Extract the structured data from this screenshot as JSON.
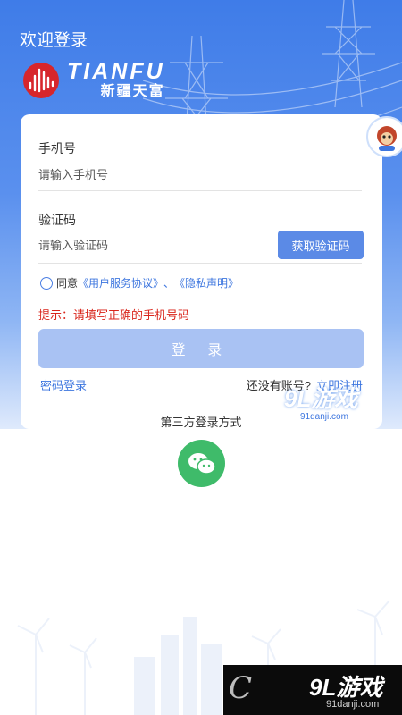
{
  "header": {
    "welcome": "欢迎登录",
    "logo_en": "TIANFU",
    "logo_cn": "新疆天富"
  },
  "form": {
    "phone_label": "手机号",
    "phone_placeholder": "请输入手机号",
    "code_label": "验证码",
    "code_placeholder": "请输入验证码",
    "get_code_label": "获取验证码",
    "agree_prefix": "同意",
    "agreement_link": "《用户服务协议》",
    "separator": "、",
    "privacy_link": "《隐私声明》",
    "hint": "提示：请填写正确的手机号码",
    "login_label": "登 录",
    "password_login": "密码登录",
    "no_account": "还没有账号?",
    "register": "立即注册"
  },
  "third_party": {
    "title": "第三方登录方式",
    "wechat_icon": "wechat-icon"
  },
  "watermarks": {
    "top_logo": "9L游戏",
    "top_url": "91danji.com",
    "bottom_logo": "9L游戏",
    "bottom_url": "91danji.com",
    "bottom_letter": "C"
  },
  "colors": {
    "primary": "#5b8ae6",
    "header_blue": "#3f7ce8",
    "hint_red": "#d9261c",
    "wechat_green": "#3fbb6a"
  }
}
